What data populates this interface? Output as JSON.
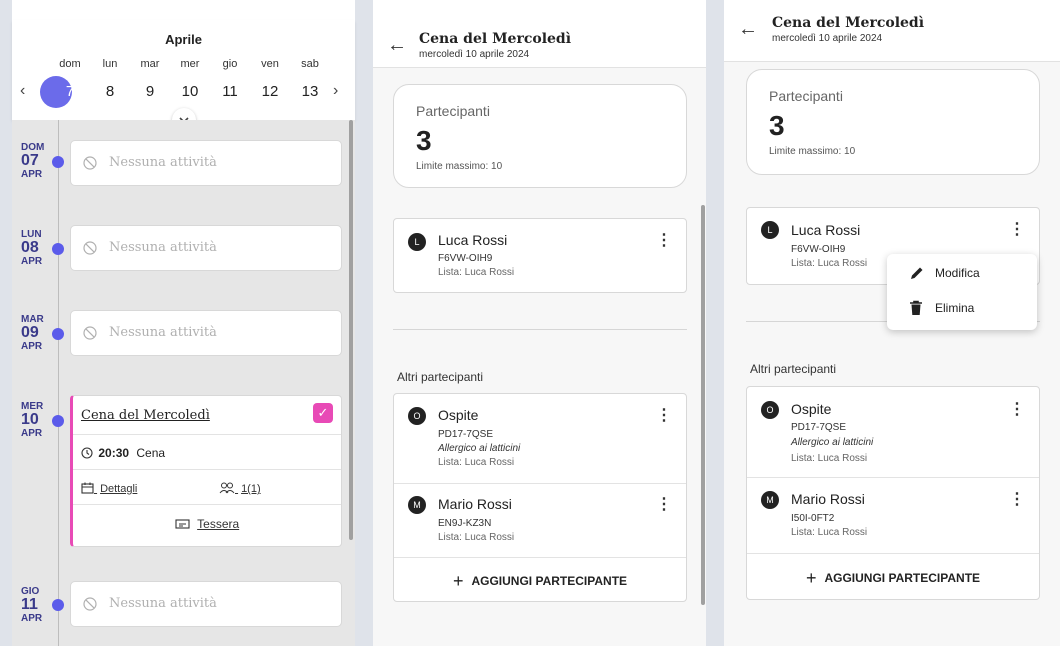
{
  "calendar": {
    "month": "Aprile",
    "day_names": [
      "dom",
      "lun",
      "mar",
      "mer",
      "gio",
      "ven",
      "sab"
    ],
    "day_numbers": [
      "7",
      "8",
      "9",
      "10",
      "11",
      "12",
      "13"
    ],
    "selected_index": 0,
    "prev": "‹",
    "next": "›",
    "expand": "⌄",
    "days": [
      {
        "dow": "DOM",
        "num": "07",
        "mon": "APR",
        "empty_text": "Nessuna attività"
      },
      {
        "dow": "LUN",
        "num": "08",
        "mon": "APR",
        "empty_text": "Nessuna attività"
      },
      {
        "dow": "MAR",
        "num": "09",
        "mon": "APR",
        "empty_text": "Nessuna attività"
      },
      {
        "dow": "MER",
        "num": "10",
        "mon": "APR"
      },
      {
        "dow": "GIO",
        "num": "11",
        "mon": "APR",
        "empty_text": "Nessuna attività"
      }
    ],
    "event": {
      "title": "Cena del Mercoledì",
      "time": "20:30",
      "type": "Cena",
      "details": "Dettagli",
      "participants": "1(1)",
      "card": "Tessera",
      "accent": "#e84ab6"
    }
  },
  "detail": {
    "back": "←",
    "title": "Cena del Mercoledì",
    "subtitle": "mercoledì 10 aprile 2024",
    "summary_label": "Partecipanti",
    "summary_count": "3",
    "summary_limit": "Limite massimo: 10",
    "main_person": {
      "initial": "L",
      "name": "Luca Rossi",
      "code": "F6VW-OIH9",
      "list": "Lista: Luca Rossi"
    },
    "others_label": "Altri partecipanti",
    "others_panel2": [
      {
        "initial": "O",
        "name": "Ospite",
        "code": "PD17-7QSE",
        "note": "Allergico ai latticini",
        "list": "Lista: Luca Rossi"
      },
      {
        "initial": "M",
        "name": "Mario Rossi",
        "code": "EN9J-KZ3N",
        "list": "Lista: Luca Rossi"
      }
    ],
    "others_panel3": [
      {
        "initial": "O",
        "name": "Ospite",
        "code": "PD17-7QSE",
        "note": "Allergico ai latticini",
        "list": "Lista: Luca Rossi"
      },
      {
        "initial": "M",
        "name": "Mario Rossi",
        "code": "I50I-0FT2",
        "list": "Lista: Luca Rossi"
      }
    ],
    "add_label": "AGGIUNGI PARTECIPANTE",
    "menu": {
      "edit": "Modifica",
      "delete": "Elimina"
    },
    "kebab": "⋮",
    "plus": "+"
  },
  "colors": {
    "accent": "#6b6bea",
    "dot": "#5b5bea",
    "event": "#e84ab6"
  }
}
